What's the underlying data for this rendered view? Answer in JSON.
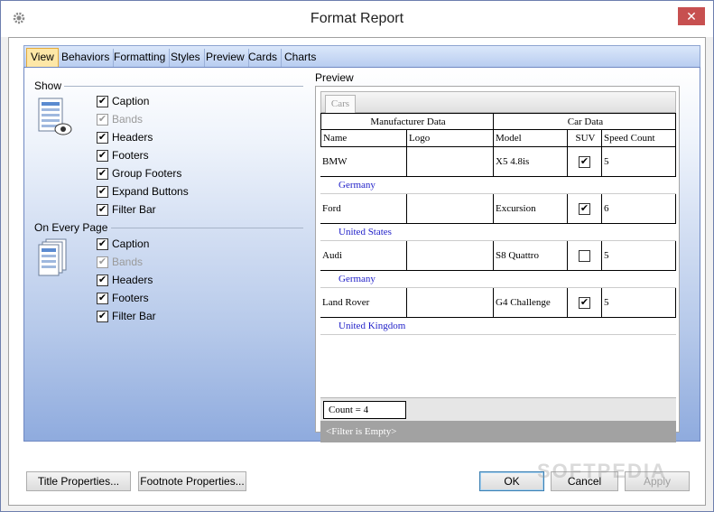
{
  "window": {
    "title": "Format Report",
    "close_glyph": "✕"
  },
  "tabs": [
    "View",
    "Behaviors",
    "Formatting",
    "Styles",
    "Preview",
    "Cards",
    "Charts"
  ],
  "active_tab": "View",
  "show_group": {
    "label": "Show",
    "items": [
      {
        "label": "Caption",
        "checked": true,
        "enabled": true
      },
      {
        "label": "Bands",
        "checked": true,
        "enabled": false
      },
      {
        "label": "Headers",
        "checked": true,
        "enabled": true
      },
      {
        "label": "Footers",
        "checked": true,
        "enabled": true
      },
      {
        "label": "Group Footers",
        "checked": true,
        "enabled": true
      },
      {
        "label": "Expand Buttons",
        "checked": true,
        "enabled": true
      },
      {
        "label": "Filter Bar",
        "checked": true,
        "enabled": true
      }
    ]
  },
  "every_page_group": {
    "label": "On Every Page",
    "items": [
      {
        "label": "Caption",
        "checked": true,
        "enabled": true
      },
      {
        "label": "Bands",
        "checked": true,
        "enabled": false
      },
      {
        "label": "Headers",
        "checked": true,
        "enabled": true
      },
      {
        "label": "Footers",
        "checked": true,
        "enabled": true
      },
      {
        "label": "Filter Bar",
        "checked": true,
        "enabled": true
      }
    ]
  },
  "preview": {
    "title": "Preview",
    "tab": "Cars",
    "bands": [
      "Manufacturer Data",
      "Car Data"
    ],
    "columns": [
      "Name",
      "Logo",
      "Model",
      "SUV",
      "Speed Count"
    ],
    "rows": [
      {
        "name": "BMW",
        "logo": "",
        "model": "X5 4.8is",
        "suv": true,
        "speed": "5",
        "group": "Germany"
      },
      {
        "name": "Ford",
        "logo": "",
        "model": "Excursion",
        "suv": true,
        "speed": "6",
        "group": "United States"
      },
      {
        "name": "Audi",
        "logo": "",
        "model": "S8 Quattro",
        "suv": false,
        "speed": "5",
        "group": "Germany"
      },
      {
        "name": "Land Rover",
        "logo": "",
        "model": "G4 Challenge",
        "suv": true,
        "speed": "5",
        "group": "United Kingdom"
      }
    ],
    "count_text": "Count = 4",
    "filter_text": "<Filter is Empty>"
  },
  "buttons": {
    "title_props": "Title Properties...",
    "footnote_props": "Footnote Properties...",
    "ok": "OK",
    "cancel": "Cancel",
    "apply": "Apply"
  },
  "watermark": "SOFTPEDIA"
}
